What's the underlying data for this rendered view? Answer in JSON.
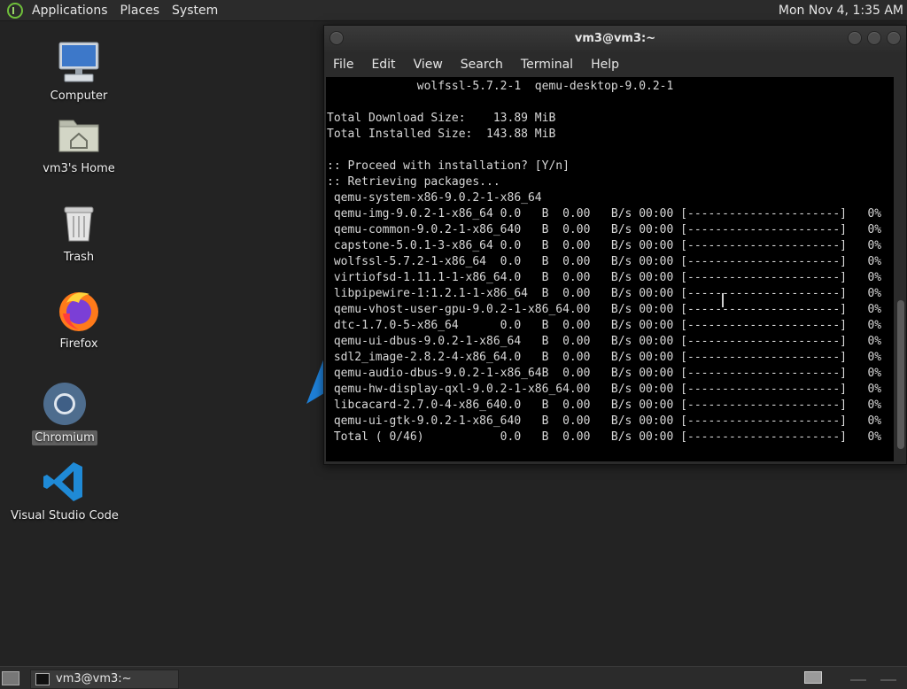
{
  "top_panel": {
    "menus": [
      "Applications",
      "Places",
      "System"
    ],
    "clock": "Mon Nov  4,  1:35 AM"
  },
  "desktop": {
    "icons": [
      {
        "label": "Computer",
        "icon": "computer-icon"
      },
      {
        "label": "vm3's Home",
        "icon": "home-folder-icon"
      },
      {
        "label": "Trash",
        "icon": "trash-icon"
      },
      {
        "label": "Firefox",
        "icon": "firefox-icon"
      },
      {
        "label": "Chromium",
        "icon": "chromium-icon"
      },
      {
        "label": "Visual Studio Code",
        "icon": "vscode-icon"
      }
    ]
  },
  "terminal": {
    "title": "vm3@vm3:~",
    "menu": [
      "File",
      "Edit",
      "View",
      "Search",
      "Terminal",
      "Help"
    ],
    "lines": [
      "             wolfssl-5.7.2-1  qemu-desktop-9.0.2-1",
      "",
      "Total Download Size:    13.89 MiB",
      "Total Installed Size:  143.88 MiB",
      "",
      ":: Proceed with installation? [Y/n]",
      ":: Retrieving packages...",
      " qemu-system-x86-9.0.2-1-x86_64",
      " qemu-img-9.0.2-1-x86_64 0.0   B  0.00   B/s 00:00 [----------------------]   0%",
      " qemu-common-9.0.2-1-x86_640   B  0.00   B/s 00:00 [----------------------]   0%",
      " capstone-5.0.1-3-x86_64 0.0   B  0.00   B/s 00:00 [----------------------]   0%",
      " wolfssl-5.7.2-1-x86_64  0.0   B  0.00   B/s 00:00 [----------------------]   0%",
      " virtiofsd-1.11.1-1-x86_64.0   B  0.00   B/s 00:00 [----------------------]   0%",
      " libpipewire-1:1.2.1-1-x86_64  B  0.00   B/s 00:00 [----------------------]   0%",
      " qemu-vhost-user-gpu-9.0.2-1-x86_64.00   B/s 00:00 [----------------------]   0%",
      " dtc-1.7.0-5-x86_64      0.0   B  0.00   B/s 00:00 [----------------------]   0%",
      " qemu-ui-dbus-9.0.2-1-x86_64   B  0.00   B/s 00:00 [----------------------]   0%",
      " sdl2_image-2.8.2-4-x86_64.0   B  0.00   B/s 00:00 [----------------------]   0%",
      " qemu-audio-dbus-9.0.2-1-x86_64B  0.00   B/s 00:00 [----------------------]   0%",
      " qemu-hw-display-qxl-9.0.2-1-x86_64.00   B/s 00:00 [----------------------]   0%",
      " libcacard-2.7.0-4-x86_640.0   B  0.00   B/s 00:00 [----------------------]   0%",
      " qemu-ui-gtk-9.0.2-1-x86_640   B  0.00   B/s 00:00 [----------------------]   0%",
      " Total ( 0/46)           0.0   B  0.00   B/s 00:00 [----------------------]   0%"
    ]
  },
  "taskbar": {
    "task_label": "vm3@vm3:~"
  },
  "colors": {
    "desktop_bg": "#232323",
    "panel_bg": "#2b2b2b",
    "terminal_bg": "#000000",
    "terminal_fg": "#d8d8d8"
  }
}
